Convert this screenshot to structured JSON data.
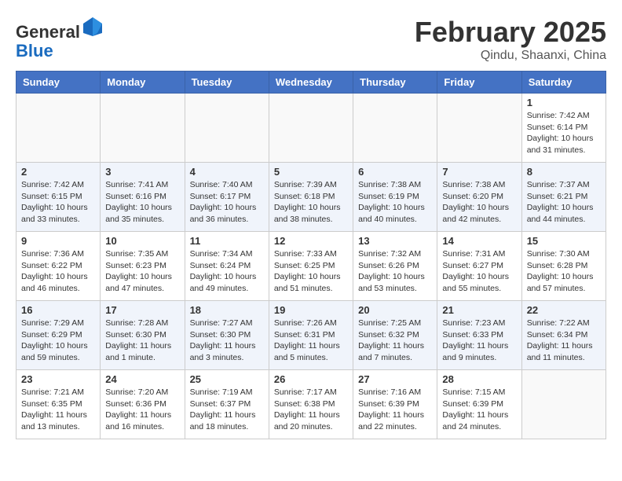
{
  "header": {
    "logo_line1": "General",
    "logo_line2": "Blue",
    "month_title": "February 2025",
    "location": "Qindu, Shaanxi, China"
  },
  "days_of_week": [
    "Sunday",
    "Monday",
    "Tuesday",
    "Wednesday",
    "Thursday",
    "Friday",
    "Saturday"
  ],
  "weeks": [
    [
      {
        "day": "",
        "info": ""
      },
      {
        "day": "",
        "info": ""
      },
      {
        "day": "",
        "info": ""
      },
      {
        "day": "",
        "info": ""
      },
      {
        "day": "",
        "info": ""
      },
      {
        "day": "",
        "info": ""
      },
      {
        "day": "1",
        "info": "Sunrise: 7:42 AM\nSunset: 6:14 PM\nDaylight: 10 hours\nand 31 minutes."
      }
    ],
    [
      {
        "day": "2",
        "info": "Sunrise: 7:42 AM\nSunset: 6:15 PM\nDaylight: 10 hours\nand 33 minutes."
      },
      {
        "day": "3",
        "info": "Sunrise: 7:41 AM\nSunset: 6:16 PM\nDaylight: 10 hours\nand 35 minutes."
      },
      {
        "day": "4",
        "info": "Sunrise: 7:40 AM\nSunset: 6:17 PM\nDaylight: 10 hours\nand 36 minutes."
      },
      {
        "day": "5",
        "info": "Sunrise: 7:39 AM\nSunset: 6:18 PM\nDaylight: 10 hours\nand 38 minutes."
      },
      {
        "day": "6",
        "info": "Sunrise: 7:38 AM\nSunset: 6:19 PM\nDaylight: 10 hours\nand 40 minutes."
      },
      {
        "day": "7",
        "info": "Sunrise: 7:38 AM\nSunset: 6:20 PM\nDaylight: 10 hours\nand 42 minutes."
      },
      {
        "day": "8",
        "info": "Sunrise: 7:37 AM\nSunset: 6:21 PM\nDaylight: 10 hours\nand 44 minutes."
      }
    ],
    [
      {
        "day": "9",
        "info": "Sunrise: 7:36 AM\nSunset: 6:22 PM\nDaylight: 10 hours\nand 46 minutes."
      },
      {
        "day": "10",
        "info": "Sunrise: 7:35 AM\nSunset: 6:23 PM\nDaylight: 10 hours\nand 47 minutes."
      },
      {
        "day": "11",
        "info": "Sunrise: 7:34 AM\nSunset: 6:24 PM\nDaylight: 10 hours\nand 49 minutes."
      },
      {
        "day": "12",
        "info": "Sunrise: 7:33 AM\nSunset: 6:25 PM\nDaylight: 10 hours\nand 51 minutes."
      },
      {
        "day": "13",
        "info": "Sunrise: 7:32 AM\nSunset: 6:26 PM\nDaylight: 10 hours\nand 53 minutes."
      },
      {
        "day": "14",
        "info": "Sunrise: 7:31 AM\nSunset: 6:27 PM\nDaylight: 10 hours\nand 55 minutes."
      },
      {
        "day": "15",
        "info": "Sunrise: 7:30 AM\nSunset: 6:28 PM\nDaylight: 10 hours\nand 57 minutes."
      }
    ],
    [
      {
        "day": "16",
        "info": "Sunrise: 7:29 AM\nSunset: 6:29 PM\nDaylight: 10 hours\nand 59 minutes."
      },
      {
        "day": "17",
        "info": "Sunrise: 7:28 AM\nSunset: 6:30 PM\nDaylight: 11 hours\nand 1 minute."
      },
      {
        "day": "18",
        "info": "Sunrise: 7:27 AM\nSunset: 6:30 PM\nDaylight: 11 hours\nand 3 minutes."
      },
      {
        "day": "19",
        "info": "Sunrise: 7:26 AM\nSunset: 6:31 PM\nDaylight: 11 hours\nand 5 minutes."
      },
      {
        "day": "20",
        "info": "Sunrise: 7:25 AM\nSunset: 6:32 PM\nDaylight: 11 hours\nand 7 minutes."
      },
      {
        "day": "21",
        "info": "Sunrise: 7:23 AM\nSunset: 6:33 PM\nDaylight: 11 hours\nand 9 minutes."
      },
      {
        "day": "22",
        "info": "Sunrise: 7:22 AM\nSunset: 6:34 PM\nDaylight: 11 hours\nand 11 minutes."
      }
    ],
    [
      {
        "day": "23",
        "info": "Sunrise: 7:21 AM\nSunset: 6:35 PM\nDaylight: 11 hours\nand 13 minutes."
      },
      {
        "day": "24",
        "info": "Sunrise: 7:20 AM\nSunset: 6:36 PM\nDaylight: 11 hours\nand 16 minutes."
      },
      {
        "day": "25",
        "info": "Sunrise: 7:19 AM\nSunset: 6:37 PM\nDaylight: 11 hours\nand 18 minutes."
      },
      {
        "day": "26",
        "info": "Sunrise: 7:17 AM\nSunset: 6:38 PM\nDaylight: 11 hours\nand 20 minutes."
      },
      {
        "day": "27",
        "info": "Sunrise: 7:16 AM\nSunset: 6:39 PM\nDaylight: 11 hours\nand 22 minutes."
      },
      {
        "day": "28",
        "info": "Sunrise: 7:15 AM\nSunset: 6:39 PM\nDaylight: 11 hours\nand 24 minutes."
      },
      {
        "day": "",
        "info": ""
      }
    ]
  ]
}
